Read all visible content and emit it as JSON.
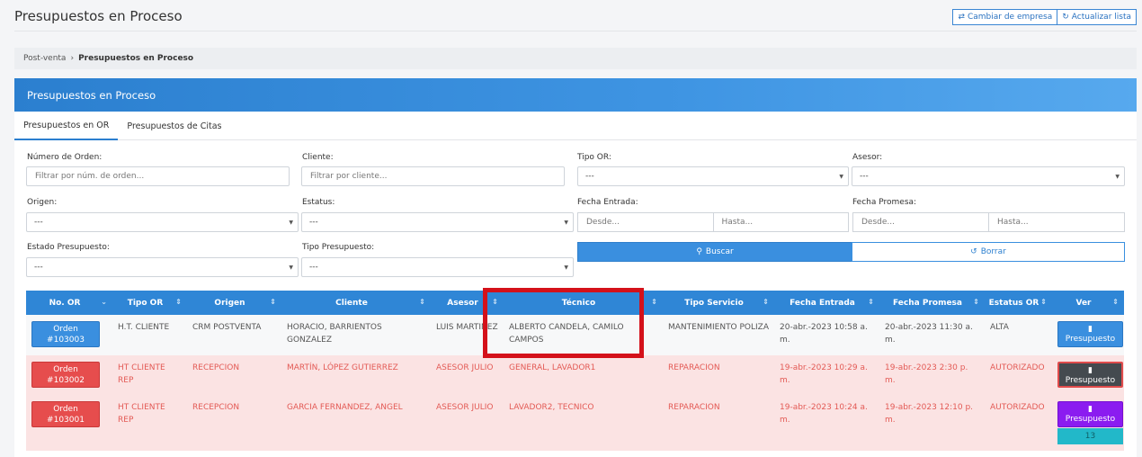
{
  "page": {
    "title": "Presupuestos en Proceso",
    "actions": [
      {
        "icon": "shuffle-icon",
        "label": "Cambiar de empresa"
      },
      {
        "icon": "refresh-icon",
        "label": "Actualizar lista"
      }
    ]
  },
  "breadcrumb": {
    "parent": "Post-venta",
    "separator": "›",
    "current": "Presupuestos en Proceso"
  },
  "card": {
    "title": "Presupuestos en Proceso"
  },
  "tabs": [
    {
      "label": "Presupuestos en OR",
      "active": true
    },
    {
      "label": "Presupuestos de Citas",
      "active": false
    }
  ],
  "filters": {
    "numero_orden": {
      "label": "Número de Orden:",
      "placeholder": "Filtrar por núm. de orden..."
    },
    "cliente": {
      "label": "Cliente:",
      "placeholder": "Filtrar por cliente..."
    },
    "tipo_or": {
      "label": "Tipo OR:",
      "value": "---"
    },
    "asesor": {
      "label": "Asesor:",
      "value": "---"
    },
    "origen": {
      "label": "Origen:",
      "value": "---"
    },
    "estatus": {
      "label": "Estatus:",
      "value": "---"
    },
    "fecha_entrada": {
      "label": "Fecha Entrada:",
      "desde": "Desde...",
      "hasta": "Hasta..."
    },
    "fecha_promesa": {
      "label": "Fecha Promesa:",
      "desde": "Desde...",
      "hasta": "Hasta..."
    },
    "estado_presupuesto": {
      "label": "Estado Presupuesto:",
      "value": "---"
    },
    "tipo_presupuesto": {
      "label": "Tipo Presupuesto:",
      "value": "---"
    },
    "buscar_label": "Buscar",
    "borrar_label": "Borrar"
  },
  "table": {
    "columns": [
      "No. OR",
      "Tipo OR",
      "Origen",
      "Cliente",
      "Asesor",
      "Técnico",
      "Tipo Servicio",
      "Fecha Entrada",
      "Fecha Promesa",
      "Estatus OR",
      "Ver"
    ],
    "rows": [
      {
        "orden_line1": "Orden",
        "orden_line2": "#103003",
        "tipo_or": "H.T. CLIENTE",
        "origen": "CRM POSTVENTA",
        "cliente": "HORACIO, BARRIENTOS GONZALEZ",
        "asesor": "LUIS MARTINEZ",
        "tecnico": "ALBERTO CANDELA, CAMILO CAMPOS",
        "tipo_servicio": "MANTENIMIENTO POLIZA",
        "fecha_entrada": "20-abr.-2023 10:58 a. m.",
        "fecha_promesa": "20-abr.-2023 11:30 a. m.",
        "estatus": "ALTA",
        "ver_label": "Presupuesto",
        "style": "blue"
      },
      {
        "orden_line1": "Orden",
        "orden_line2": "#103002",
        "tipo_or": "HT CLIENTE REP",
        "origen": "RECEPCION",
        "cliente": "MARTÍN, LÓPEZ GUTIERREZ",
        "asesor": "ASESOR JULIO",
        "tecnico": "GENERAL, LAVADOR1",
        "tipo_servicio": "REPARACION",
        "fecha_entrada": "19-abr.-2023 10:29 a. m.",
        "fecha_promesa": "19-abr.-2023 2:30 p. m.",
        "estatus": "AUTORIZADO",
        "ver_label": "Presupuesto",
        "style": "dark"
      },
      {
        "orden_line1": "Orden",
        "orden_line2": "#103001",
        "tipo_or": "HT CLIENTE REP",
        "origen": "RECEPCION",
        "cliente": "GARCIA FERNANDEZ, ANGEL",
        "asesor": "ASESOR JULIO",
        "tecnico": "LAVADOR2, TECNICO",
        "tipo_servicio": "REPARACION",
        "fecha_entrada": "19-abr.-2023 10:24 a. m.",
        "fecha_promesa": "19-abr.-2023 12:10 p. m.",
        "estatus": "AUTORIZADO",
        "ver_label": "Presupuesto",
        "style": "purple",
        "badge": "13"
      }
    ]
  },
  "colors": {
    "primary": "#2f86d6",
    "danger": "#e64d4d",
    "purple": "#8b1cf0",
    "teal": "#22b8c9",
    "highlight": "#d4111a"
  }
}
